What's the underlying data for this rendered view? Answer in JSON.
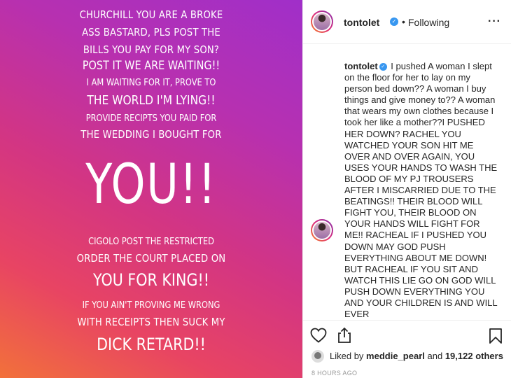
{
  "story": {
    "line1": "CHURCHILL YOU ARE A BROKE",
    "line2": "ASS BASTARD, PLS POST THE",
    "line3": "BILLS YOU PAY FOR MY SON?",
    "line4": "POST IT WE ARE WAITING!!",
    "line5": "I AM WAITING FOR IT, PROVE TO",
    "line6": "THE WORLD I'M LYING!!",
    "line7": "PROVIDE RECIPTS YOU PAID FOR",
    "line8": "THE WEDDING I BOUGHT FOR",
    "big": "YOU!!",
    "line9": "CIGOLO POST THE RESTRICTED",
    "line10": "ORDER THE COURT PLACED ON",
    "line11": "YOU FOR KING!!",
    "line12": "IF YOU AIN'T PROVING ME WRONG",
    "line13": "WITH RECEIPTS THEN SUCK MY",
    "line14": "DICK RETARD!!"
  },
  "header": {
    "username": "tontolet",
    "verified_icon": "✓",
    "separator": "•",
    "follow_status": "Following",
    "more": "···"
  },
  "caption": {
    "username": "tontolet",
    "verified_icon": "✓",
    "text": "I pushed A woman I slept on the floor for her to lay on my person bed down?? A woman I buy things and give money to?? A woman that wears my own clothes because I took her like a mother??I PUSHED HER DOWN? RACHEL YOU WATCHED YOUR SON HIT ME OVER AND OVER AGAIN, YOU USES YOUR HANDS TO WASH THE BLOOD OF MY PJ TROUSERS AFTER I MISCARRIED DUE TO THE BEATINGS!! THEIR BLOOD WILL FIGHT YOU, THEIR BLOOD ON YOUR HANDS WILL FIGHT FOR ME!! RACHEAL IF I PUSHED YOU DOWN MAY GOD PUSH EVERYTHING ABOUT ME DOWN! BUT RACHEAL IF YOU SIT AND WATCH THIS LIE GO ON GOD WILL PUSH DOWN EVERYTHING YOU AND YOUR CHILDREN IS AND WILL EVER"
  },
  "actions": {
    "like_icon": "heart-outline-icon",
    "share_icon": "share-icon",
    "save_icon": "bookmark-icon"
  },
  "likes": {
    "prefix": "Liked by",
    "user": "meddie_pearl",
    "middle": "and",
    "count": "19,122 others"
  },
  "timestamp": "8 HOURS AGO"
}
